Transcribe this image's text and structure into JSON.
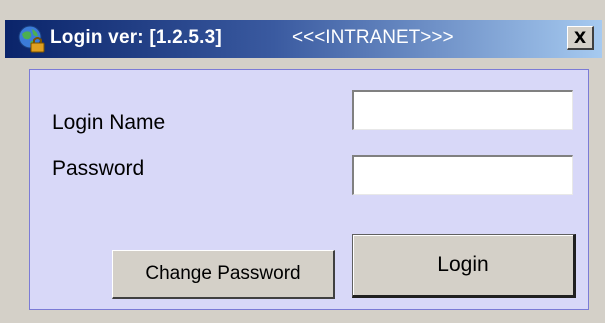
{
  "window": {
    "title": "Login ver: [1.2.5.3]",
    "environment": "<<<INTRANET>>>",
    "close_label": "X",
    "icon": "globe-key-icon"
  },
  "form": {
    "login_name_label": "Login Name",
    "login_name_value": "",
    "password_label": "Password",
    "password_value": ""
  },
  "buttons": {
    "change_password": "Change Password",
    "login": "Login"
  },
  "colors": {
    "title_bar_start": "#0a246a",
    "title_bar_end": "#a6caf0",
    "panel_background": "#d8d8f8",
    "panel_border": "#7b7bd6",
    "button_face": "#d4d0c8"
  }
}
